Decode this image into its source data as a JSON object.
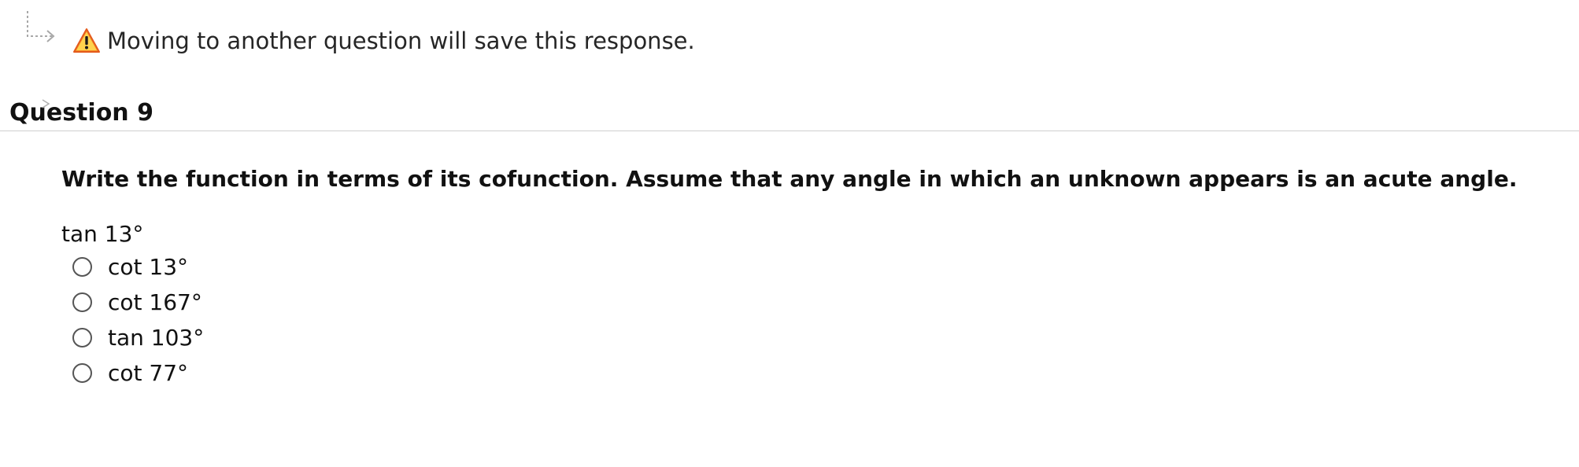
{
  "notice": {
    "text": "Moving to another question will save this response.",
    "redirect_icon": "redirect-arrow-icon",
    "warning_icon": "warning-icon",
    "warning_color": "#f28c28"
  },
  "question": {
    "title": "Question 9",
    "prompt": "Write the function in terms of its cofunction. Assume that any angle in which an unknown appears is an acute angle.",
    "expression": "tan 13°",
    "options": [
      {
        "label": "cot 13°"
      },
      {
        "label": "cot 167°"
      },
      {
        "label": "tan 103°"
      },
      {
        "label": "cot 77°"
      }
    ]
  }
}
